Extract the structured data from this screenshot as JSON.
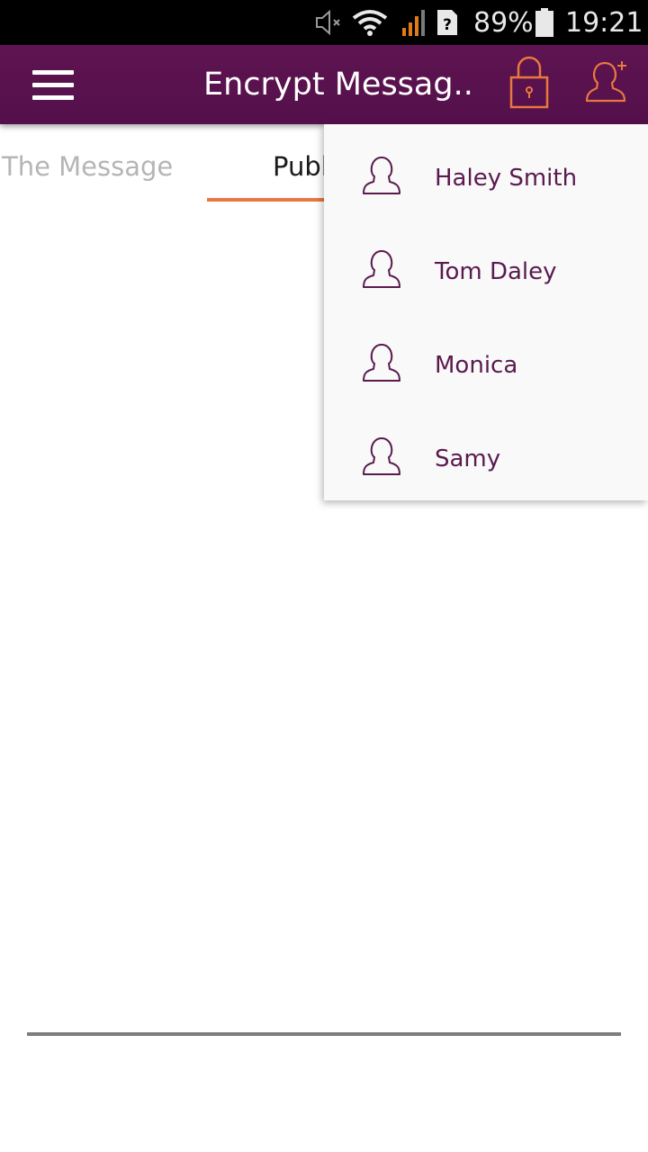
{
  "status_bar": {
    "battery": "89%",
    "time": "19:21",
    "icons": [
      "mute-icon",
      "wifi-icon",
      "signal-icon",
      "sim-unknown-icon",
      "battery-icon"
    ]
  },
  "app_bar": {
    "title": "Encrypt Messag..",
    "icons": [
      "menu-icon",
      "lock-icon",
      "add-user-icon"
    ],
    "background_color": "#5a1250",
    "accent_color": "#e8783e"
  },
  "tabs": [
    {
      "label": "The Message",
      "selected": false
    },
    {
      "label": "Publ",
      "selected": true
    }
  ],
  "contacts_menu": {
    "items": [
      {
        "name": "Haley Smith",
        "icon": "person-icon"
      },
      {
        "name": "Tom Daley",
        "icon": "person-icon"
      },
      {
        "name": "Monica",
        "icon": "person-icon"
      },
      {
        "name": "Samy",
        "icon": "person-icon"
      }
    ],
    "text_color": "#5a1a4e"
  }
}
